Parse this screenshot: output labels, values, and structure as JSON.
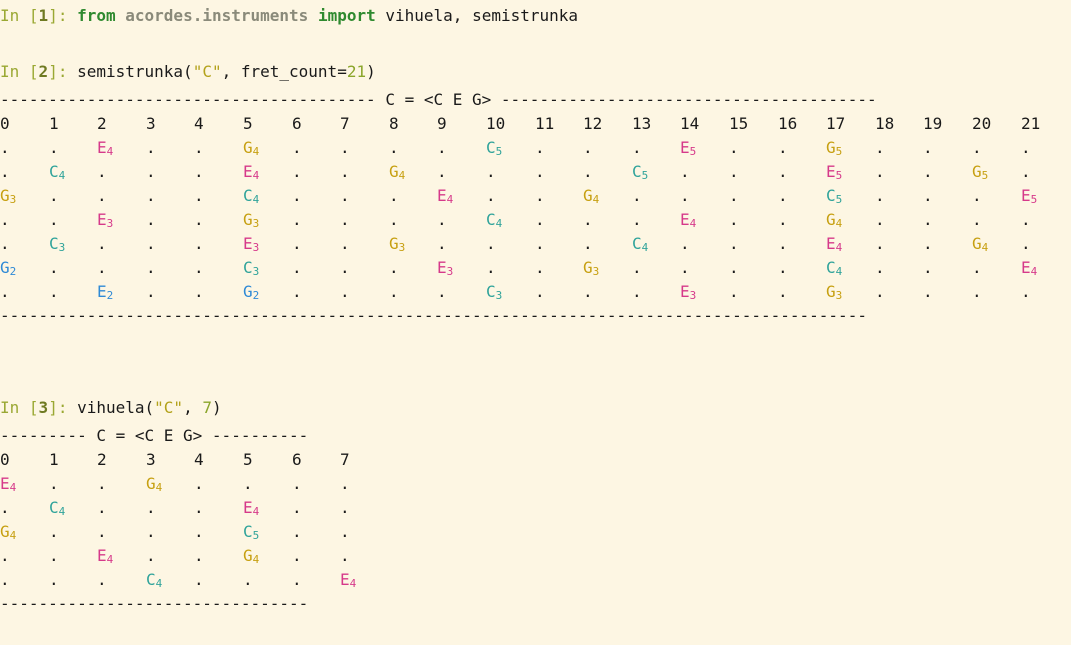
{
  "cells": [
    {
      "prompt": "In ",
      "num": "1",
      "code_parts": [
        {
          "t": "from",
          "c": "kw"
        },
        {
          "t": " ",
          "c": ""
        },
        {
          "t": "acordes.instruments",
          "c": "mod"
        },
        {
          "t": " ",
          "c": ""
        },
        {
          "t": "import",
          "c": "kw"
        },
        {
          "t": " vihuela, semistrunka",
          "c": ""
        }
      ]
    },
    {
      "prompt": "In ",
      "num": "2",
      "code_parts": [
        {
          "t": "semistrunka(",
          "c": ""
        },
        {
          "t": "\"C\"",
          "c": "str"
        },
        {
          "t": ", fret_count=",
          "c": ""
        },
        {
          "t": "21",
          "c": "numlit"
        },
        {
          "t": ")",
          "c": ""
        }
      ]
    },
    {
      "prompt": "In ",
      "num": "3",
      "code_parts": [
        {
          "t": "vihuela(",
          "c": ""
        },
        {
          "t": "\"C\"",
          "c": "str"
        },
        {
          "t": ", ",
          "c": ""
        },
        {
          "t": "7",
          "c": "numlit"
        },
        {
          "t": ")",
          "c": ""
        }
      ]
    }
  ],
  "semistrunka": {
    "title_line": "--------------------------------------- C = <C E G> ---------------------------------------",
    "bottom_line": "------------------------------------------------------------------------------------------",
    "frets": [
      "0",
      "1",
      "2",
      "3",
      "4",
      "5",
      "6",
      "7",
      "8",
      "9",
      "10",
      "11",
      "12",
      "13",
      "14",
      "15",
      "16",
      "17",
      "18",
      "19",
      "20",
      "21"
    ],
    "rows": [
      [
        ".",
        ".",
        "E4",
        ".",
        ".",
        "G4",
        ".",
        ".",
        ".",
        ".",
        "C5",
        ".",
        ".",
        ".",
        "E5",
        ".",
        ".",
        "G5",
        ".",
        ".",
        ".",
        "."
      ],
      [
        ".",
        "C4",
        ".",
        ".",
        ".",
        "E4",
        ".",
        ".",
        "G4",
        ".",
        ".",
        ".",
        ".",
        "C5",
        ".",
        ".",
        ".",
        "E5",
        ".",
        ".",
        "G5",
        "."
      ],
      [
        "G3",
        ".",
        ".",
        ".",
        ".",
        "C4",
        ".",
        ".",
        ".",
        "E4",
        ".",
        ".",
        "G4",
        ".",
        ".",
        ".",
        ".",
        "C5",
        ".",
        ".",
        ".",
        "E5"
      ],
      [
        ".",
        ".",
        "E3",
        ".",
        ".",
        "G3",
        ".",
        ".",
        ".",
        ".",
        "C4",
        ".",
        ".",
        ".",
        "E4",
        ".",
        ".",
        "G4",
        ".",
        ".",
        ".",
        "."
      ],
      [
        ".",
        "C3",
        ".",
        ".",
        ".",
        "E3",
        ".",
        ".",
        "G3",
        ".",
        ".",
        ".",
        ".",
        "C4",
        ".",
        ".",
        ".",
        "E4",
        ".",
        ".",
        "G4",
        "."
      ],
      [
        "G2",
        ".",
        ".",
        ".",
        ".",
        "C3",
        ".",
        ".",
        ".",
        "E3",
        ".",
        ".",
        "G3",
        ".",
        ".",
        ".",
        ".",
        "C4",
        ".",
        ".",
        ".",
        "E4"
      ],
      [
        ".",
        ".",
        "E2",
        ".",
        ".",
        "G2",
        ".",
        ".",
        ".",
        ".",
        "C3",
        ".",
        ".",
        ".",
        "E3",
        ".",
        ".",
        "G3",
        ".",
        ".",
        ".",
        "."
      ]
    ]
  },
  "vihuela": {
    "title_line": "--------- C = <C E G> ----------",
    "bottom_line": "--------------------------------",
    "frets": [
      "0",
      "1",
      "2",
      "3",
      "4",
      "5",
      "6",
      "7"
    ],
    "rows": [
      [
        "E4",
        ".",
        ".",
        "G4",
        ".",
        ".",
        ".",
        "."
      ],
      [
        ".",
        "C4",
        ".",
        ".",
        ".",
        "E4",
        ".",
        "."
      ],
      [
        "G4",
        ".",
        ".",
        ".",
        ".",
        "C5",
        ".",
        "."
      ],
      [
        ".",
        ".",
        "E4",
        ".",
        ".",
        "G4",
        ".",
        "."
      ],
      [
        ".",
        ".",
        ".",
        "C4",
        ".",
        ".",
        ".",
        "E4"
      ]
    ]
  },
  "colors": {
    "background": "#fdf6e3",
    "E": "#d6398a",
    "G": "#c7a012",
    "C": "#2fa39a",
    "octave2": "#2f8ad6"
  }
}
